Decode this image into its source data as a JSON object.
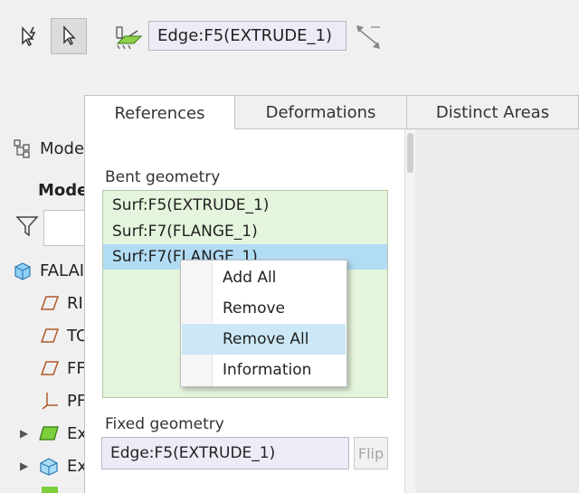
{
  "toolbar": {
    "reference_value": "Edge:F5(EXTRUDE_1)"
  },
  "tree": {
    "header_label": "Mode",
    "subheader_label": "Mode",
    "rows": [
      {
        "label": "FALAI",
        "icon": "part-icon"
      },
      {
        "label": "RI",
        "icon": "datum-plane-icon"
      },
      {
        "label": "TC",
        "icon": "datum-plane-icon"
      },
      {
        "label": "FF",
        "icon": "datum-plane-icon"
      },
      {
        "label": "PF",
        "icon": "coordinate-system-icon"
      },
      {
        "label": "Ex",
        "icon": "sheetmetal-feature-icon"
      },
      {
        "label": "Ex",
        "icon": "extrude-feature-icon"
      }
    ]
  },
  "tabs": [
    {
      "label": "References",
      "active": true
    },
    {
      "label": "Deformations",
      "active": false
    },
    {
      "label": "Distinct Areas",
      "active": false
    }
  ],
  "panel": {
    "bent_geometry_label": "Bent geometry",
    "bent_items": [
      "Surf:F5(EXTRUDE_1)",
      "Surf:F7(FLANGE_1)",
      "Surf:F7(FLANGE_1)"
    ],
    "fixed_geometry_label": "Fixed geometry",
    "fixed_value": "Edge:F5(EXTRUDE_1)",
    "flip_label": "Flip"
  },
  "context_menu": {
    "items": [
      "Add All",
      "Remove",
      "Remove All",
      "Information"
    ]
  },
  "colors": {
    "list_bg": "#e5f4dc",
    "selection": "#b1dcf4",
    "menu_hover": "#cce8f6",
    "field_bg": "#ececf7"
  }
}
